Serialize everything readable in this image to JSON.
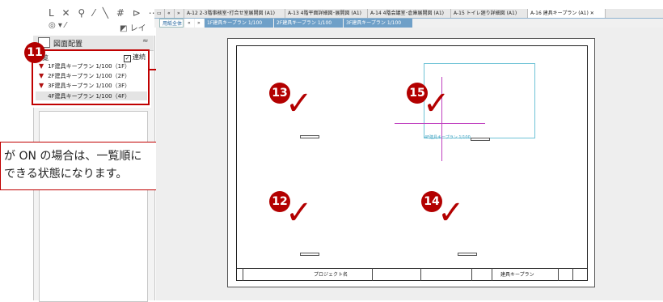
{
  "toolbar": {
    "row1_tools": "L ✕ ⚲ ⁄ ╲ # ⊳ ⋯ ▥",
    "row2_left": "◎ ▾  ⁄",
    "layer_label": "レイヤ"
  },
  "panel": {
    "title": "図面配置",
    "collapse_glyph": "≈",
    "list_label": "一覧",
    "renzoku_label": "連続",
    "renzoku_checked": true,
    "items": [
      {
        "label": "1F建具キープラン 1/100（1F）"
      },
      {
        "label": "2F建具キープラン 1/100（2F）"
      },
      {
        "label": "3F建具キープラン 1/100（3F）"
      },
      {
        "label": "4F建具キープラン 1/100（4F）"
      }
    ],
    "pin_glyph": "▼"
  },
  "annotation": {
    "badge_11": "11",
    "callout_line1": "が ON の場合は、一覧順に",
    "callout_line2": "できる状態になります。"
  },
  "tabs": {
    "nav_prev": "«",
    "nav_next": "»",
    "items": [
      {
        "label": "A-12 2-3階事務室･打合せ室展開図 (A1)"
      },
      {
        "label": "A-13 4階平面詳細図･展開図 (A1)"
      },
      {
        "label": "A-14 4階会議室･倉庫展開図 (A1)"
      },
      {
        "label": "A-15 トイレ廻り詳細図 (A1)"
      },
      {
        "label": "A-16 建具キープラン (A1)  ✕"
      }
    ],
    "sub_items": [
      {
        "label": "用紙全体"
      },
      {
        "label": "«"
      },
      {
        "label": "»"
      },
      {
        "label": "1F建具キープラン 1/100"
      },
      {
        "label": "2F建具キープラン 1/100"
      },
      {
        "label": "3F建具キープラン 1/100"
      }
    ]
  },
  "drawing": {
    "badges": [
      "13",
      "15",
      "12",
      "14"
    ],
    "check_glyph": "✓",
    "cyan_label": "4F建具キープラン 1/100",
    "project_label": "プロジェクト名",
    "drawing_title": "建具キープラン"
  },
  "colors": {
    "accent_red": "#b30000",
    "highlight_red": "#c00000",
    "cyan": "#6fc3d6",
    "magenta": "#c040c0",
    "pin_red": "#b01010"
  }
}
